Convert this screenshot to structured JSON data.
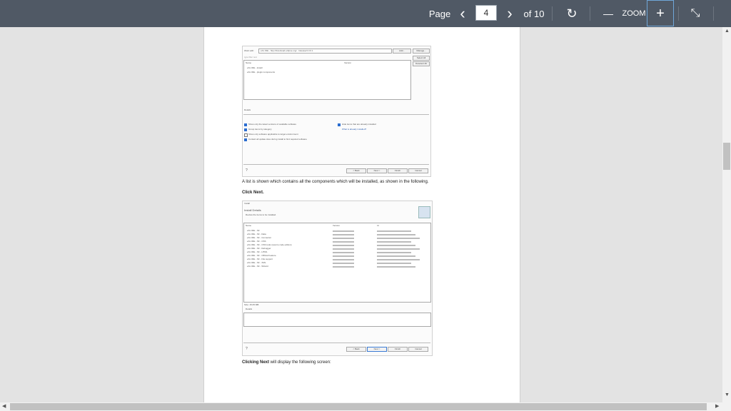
{
  "toolbar": {
    "page_label": "Page",
    "current_page": "4",
    "of_pages": "of 10",
    "zoom_label": "ZOOM",
    "prev_icon": "‹",
    "next_icon": "›",
    "rotate_icon": "↻",
    "zoom_out_icon": "—",
    "zoom_in_icon": "+",
    "collapse_icon": "⤡"
  },
  "document": {
    "text1": "A list is shown which contains all the components which will be installed, as shown in the following.",
    "text2": "Click Next.",
    "text3_bold": "Clicking Next",
    "text3_rest": " will display the following screen:"
  },
  "shot1": {
    "work_with": "Work with:",
    "url": "eXo IDE - http://download.eclipse.org/.../release/4.3.0.1",
    "add": "Add...",
    "manage": "Manage...",
    "filter": "type filter text",
    "select_all": "Select All",
    "deselect_all": "Deselect All",
    "col_name": "Name",
    "col_version": "Version",
    "item1": "eXo IDE - install",
    "item2": "eXo IDE - plugin components",
    "details": "Details",
    "opt1": "Show only the latest versions of available software",
    "opt2": "Group items by category",
    "opt3": "Show only software applicable to target environment",
    "opt4": "Contact all update sites during install to find required software",
    "opt5": "Hide items that are already installed",
    "opt6": "What is already installed?",
    "back": "< Back",
    "next": "Next >",
    "finish": "Finish",
    "cancel": "Cancel"
  },
  "shot2": {
    "window": "Install",
    "heading": "Install Details",
    "sub": "Review the items to be installed.",
    "col_name": "Name",
    "col_version": "Version",
    "col_id": "Id",
    "rows": [
      "eXo IDE - SF",
      "eXo IDE - SF - Data",
      "eXo IDE - SF - Connector",
      "eXo IDE - SF - CSS",
      "eXo IDE - SF - CSS tools (source code edition)",
      "eXo IDE - SF - Debugger",
      "eXo IDE - SF - HTML",
      "eXo IDE - SF - Official Feature",
      "eXo IDE - SF - File support",
      "eXo IDE - SF - XML",
      "eXo IDE - SF - Wizard"
    ],
    "size": "Size: 15.05 MB",
    "details": "Details",
    "back": "< Back",
    "next": "Next >",
    "finish": "Finish",
    "cancel": "Cancel"
  }
}
